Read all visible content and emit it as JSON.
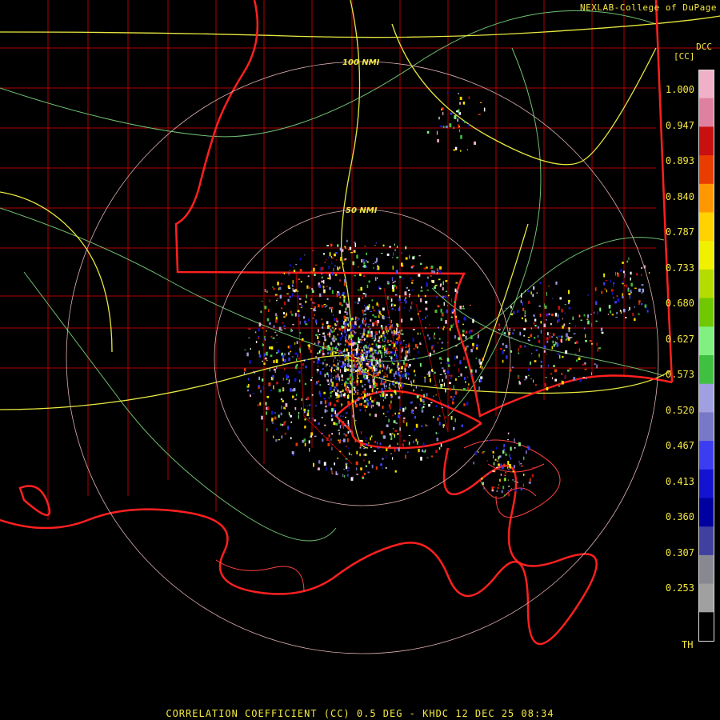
{
  "credit": "NEXLAB-College of DuPage",
  "footer": "CORRELATION COEFFICIENT (CC) 0.5 DEG - KHDC 12 DEC 25 08:34",
  "legend": {
    "product": "DCC",
    "unit": "[CC]",
    "ticks": [
      "1.000",
      "0.947",
      "0.893",
      "0.840",
      "0.787",
      "0.733",
      "0.680",
      "0.627",
      "0.573",
      "0.520",
      "0.467",
      "0.413",
      "0.360",
      "0.307",
      "0.253"
    ],
    "threshold_label": "TH",
    "colors": [
      "#f0b0c8",
      "#e080a0",
      "#c81010",
      "#e83c00",
      "#ff9800",
      "#ffd200",
      "#f0f000",
      "#b4dc00",
      "#70c800",
      "#80f080",
      "#40c040",
      "#a0a0e0",
      "#7878c8",
      "#3c3cf0",
      "#1414d0",
      "#0000a0",
      "#4040a0",
      "#888890",
      "#a0a0a0",
      "#000000"
    ]
  },
  "rings": [
    "100 NMI",
    "50 NMI"
  ],
  "colors": {
    "state_border": "#ff2020",
    "county_border": "#b00000",
    "highway": "#e8e840",
    "minor_road": "#70c070",
    "range_ring": "#e0b0b0",
    "text": "#f4e842"
  }
}
